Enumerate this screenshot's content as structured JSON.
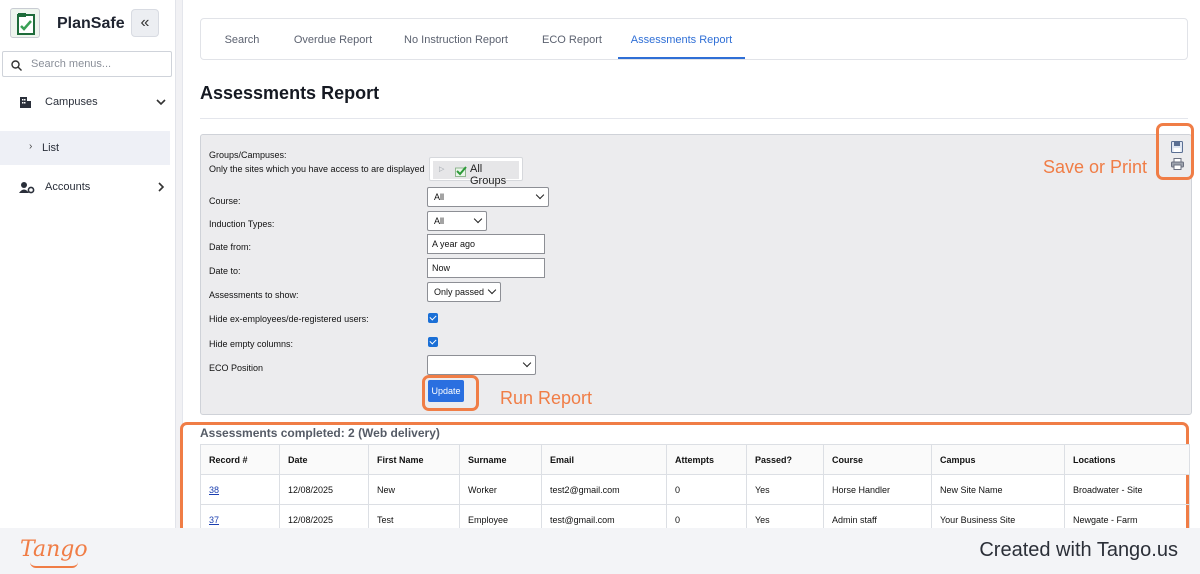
{
  "app": {
    "name": "PlanSafe",
    "collapse_icon": "«"
  },
  "sidebar": {
    "search_placeholder": "Search menus...",
    "items": [
      {
        "label": "Campuses",
        "icon": "building-icon",
        "expanded": true
      },
      {
        "label": "List",
        "sub": true
      },
      {
        "label": "Accounts",
        "icon": "users-gear-icon",
        "expanded": false
      }
    ]
  },
  "tabs": [
    {
      "label": "Search",
      "active": false
    },
    {
      "label": "Overdue Report",
      "active": false
    },
    {
      "label": "No Instruction Report",
      "active": false
    },
    {
      "label": "ECO Report",
      "active": false
    },
    {
      "label": "Assessments Report",
      "active": true
    }
  ],
  "page": {
    "title": "Assessments Report"
  },
  "form": {
    "groups_label_1": "Groups/Campuses:",
    "groups_label_2": "Only the sites which you have access to are displayed",
    "groups_button": "All Groups",
    "course_label": "Course:",
    "course_value": "All",
    "induction_label": "Induction Types:",
    "induction_value": "All",
    "date_from_label": "Date from:",
    "date_from_value": "A year ago",
    "date_to_label": "Date to:",
    "date_to_value": "Now",
    "assessments_label": "Assessments to show:",
    "assessments_value": "Only passed",
    "hide_ex_label": "Hide ex-employees/de-registered users:",
    "hide_ex_checked": true,
    "hide_empty_label": "Hide empty columns:",
    "hide_empty_checked": true,
    "eco_label": "ECO Position",
    "eco_value": "",
    "update_button": "Update"
  },
  "annotations": {
    "save_print": "Save or Print",
    "run_report": "Run Report",
    "color": "#f07d46"
  },
  "results": {
    "title": "Assessments completed: 2 (Web delivery)",
    "columns": [
      "Record #",
      "Date",
      "First Name",
      "Surname",
      "Email",
      "Attempts",
      "Passed?",
      "Course",
      "Campus",
      "Locations"
    ],
    "rows": [
      {
        "record": "38",
        "date": "12/08/2025",
        "first": "New",
        "surname": "Worker",
        "email": "test2@gmail.com",
        "attempts": "0",
        "passed": "Yes",
        "course": "Horse Handler",
        "campus": "New Site Name",
        "locations": "Broadwater - Site"
      },
      {
        "record": "37",
        "date": "12/08/2025",
        "first": "Test",
        "surname": "Employee",
        "email": "test@gmail.com",
        "attempts": "0",
        "passed": "Yes",
        "course": "Admin staff",
        "campus": "Your Business Site",
        "locations": "Newgate - Farm"
      }
    ]
  },
  "footer": {
    "logo": "Tango",
    "created": "Created with Tango.us"
  },
  "colors": {
    "accent": "#2f6fd6",
    "annotation": "#f07d46"
  }
}
